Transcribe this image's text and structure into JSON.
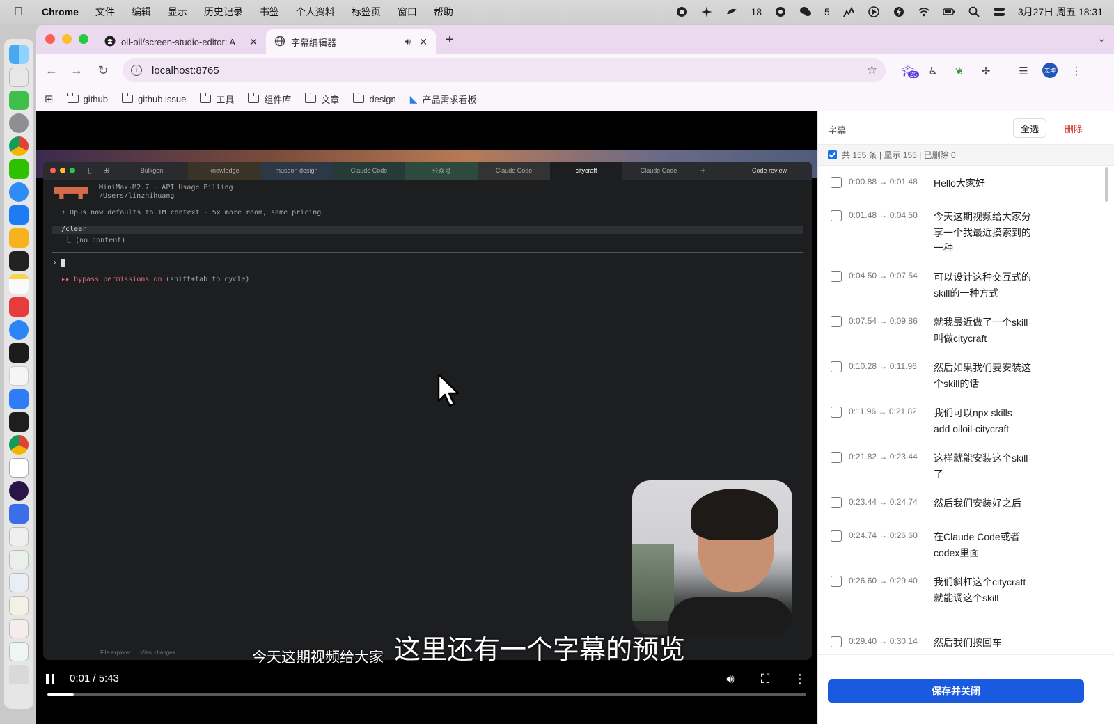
{
  "menubar": {
    "app_name": "Chrome",
    "items": [
      "文件",
      "编辑",
      "显示",
      "历史记录",
      "书签",
      "个人资料",
      "标签页",
      "窗口",
      "帮助"
    ],
    "badge_18": "18",
    "badge_5": "5",
    "datetime": "3月27日 周五 18:31"
  },
  "tabs": [
    {
      "title": "oil-oil/screen-studio-editor: A",
      "icon": "github-icon"
    },
    {
      "title": "字幕编辑器",
      "icon": "globe-icon",
      "audio": true
    }
  ],
  "toolbar": {
    "url": "localhost:8765",
    "extension_badge": "25",
    "profile_label": "志坤"
  },
  "bookmarks": [
    "github",
    "github issue",
    "工具",
    "组件库",
    "文章",
    "design",
    "产品需求看板"
  ],
  "terminal": {
    "tabs": [
      "Bulkgen",
      "knowledge",
      "museon design",
      "Claude Code",
      "公众号",
      "Claude Code",
      "citycraft",
      "Claude Code"
    ],
    "review_label": "Code review",
    "line1": "MiniMax-M2.7 · API Usage Billing",
    "line2": "/Users/linzhihuang",
    "line3": "↑ Opus now defaults to 1M context · 5x more room, same pricing",
    "line4": "/clear",
    "line5": "⎿ (no content)",
    "prompt": "›",
    "bypass": "▸▸ bypass permissions on",
    "bypass_hint": "(shift+tab to cycle)",
    "footer_items": [
      "File explorer",
      "View changes"
    ]
  },
  "player": {
    "subtitle_current": "今天这期视频给大家",
    "subtitle_overlay": "这里还有一个字幕的预览",
    "time": "0:01 / 5:43",
    "progress_fraction": 0.035
  },
  "panel": {
    "title": "字幕",
    "select_all": "全选",
    "delete": "删除",
    "summary": "共 155 条 | 显示 155 | 已删除 0",
    "save": "保存并关闭",
    "rows": [
      {
        "range": "0:00.88 → 0:01.48",
        "text": "Hello大家好"
      },
      {
        "range": "0:01.48 → 0:04.50",
        "text": "今天这期视频给大家分享一个我最近摸索到的一种"
      },
      {
        "range": "0:04.50 → 0:07.54",
        "text": "可以设计这种交互式的skill的一种方式"
      },
      {
        "range": "0:07.54 → 0:09.86",
        "text": "就我最近做了一个skill叫做citycraft"
      },
      {
        "range": "0:10.28 → 0:11.96",
        "text": "然后如果我们要安装这个skill的话"
      },
      {
        "range": "0:11.96 → 0:21.82",
        "text": "我们可以npx skills add oiloil-citycraft"
      },
      {
        "range": "0:21.82 → 0:23.44",
        "text": "这样就能安装这个skill了"
      },
      {
        "range": "0:23.44 → 0:24.74",
        "text": "然后我们安装好之后"
      },
      {
        "range": "0:24.74 → 0:26.60",
        "text": "在Claude Code或者codex里面"
      },
      {
        "range": "0:26.60 → 0:29.40",
        "text": "我们斜杠这个citycraft就能调这个skill"
      },
      {
        "range": "0:29.40 → 0:30.14",
        "text": "然后我们按回车"
      }
    ]
  },
  "colors": {
    "accent": "#1a5ae0",
    "danger": "#d0342c",
    "tabstrip": "#ead9ef"
  }
}
